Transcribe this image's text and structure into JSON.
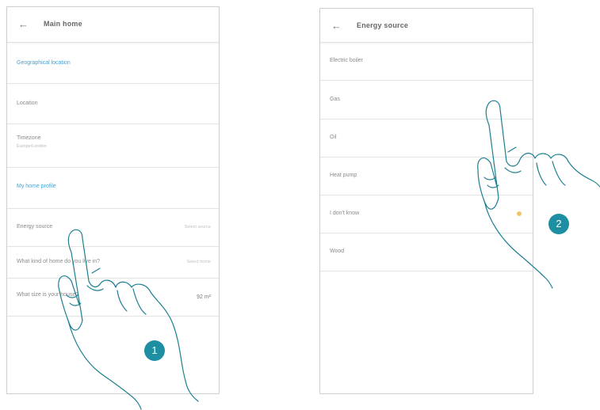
{
  "left_screen": {
    "back_icon": "arrow-left-icon",
    "title": "Main home",
    "rows": [
      {
        "type": "section",
        "label": "Geographical location"
      },
      {
        "type": "item",
        "label": "Location",
        "sub": "",
        "value": ""
      },
      {
        "type": "item",
        "label": "Timezone",
        "sub": "Europe/London",
        "value": ""
      },
      {
        "type": "section",
        "label": "My home profile"
      },
      {
        "type": "item",
        "label": "Energy source",
        "sub": "",
        "value": "Select source"
      },
      {
        "type": "item",
        "label": "What kind of home do you live in?",
        "sub": "",
        "value": "Select home"
      },
      {
        "type": "item",
        "label": "What size is your house?",
        "sub": "",
        "value": "92 m²"
      }
    ],
    "step_badge": "1"
  },
  "right_screen": {
    "back_icon": "arrow-left-icon",
    "title": "Energy source",
    "rows": [
      {
        "label": "Electric boiler"
      },
      {
        "label": "Gas"
      },
      {
        "label": "Oil"
      },
      {
        "label": "Heat pump"
      },
      {
        "label": "I don't know"
      },
      {
        "label": "Wood"
      }
    ],
    "step_badge": "2"
  },
  "colors": {
    "accent_blue": "#3fa4d6",
    "badge": "#1e8fa2",
    "hand_stroke": "#1c7f91"
  }
}
